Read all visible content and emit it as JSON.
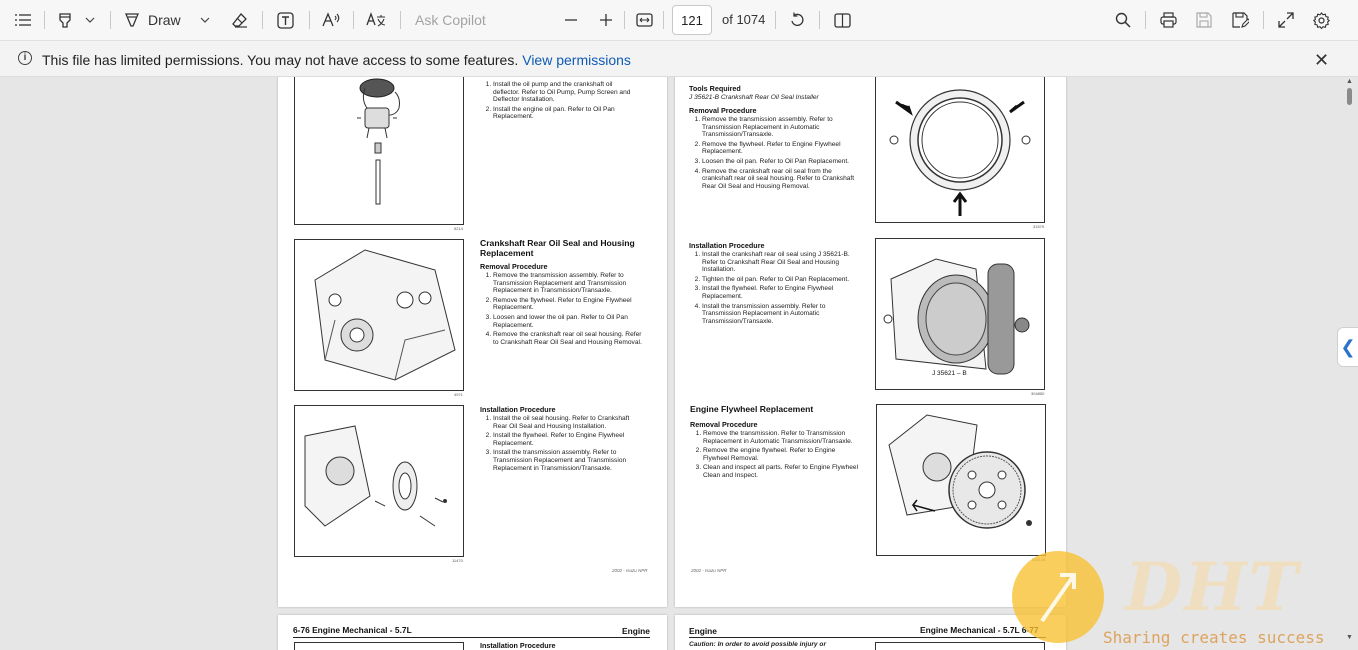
{
  "toolbar": {
    "draw_label": "Draw",
    "ask_copilot_placeholder": "Ask Copilot",
    "current_page": "121",
    "page_total": "of 1074"
  },
  "infobar": {
    "message": "This file has limited permissions. You may not have access to some features.",
    "link": "View permissions"
  },
  "page_left_top": {
    "install_steps": [
      "Install the oil pump and the crankshaft oil deflector. Refer to Oil Pump, Pump Screen and Deflector Installation.",
      "Install the engine oil pan. Refer to Oil Pan Replacement."
    ],
    "fig1_num": "5214",
    "section_title": "Crankshaft Rear Oil Seal and Housing Replacement",
    "removal_heading": "Removal Procedure",
    "removal_steps": [
      "Remove the transmission assembly. Refer to Transmission Replacement and Transmission Replacement in Transmission/Transaxle.",
      "Remove the flywheel. Refer to Engine Flywheel Replacement.",
      "Loosen and lower the oil pan. Refer to Oil Pan Replacement.",
      "Remove the crankshaft rear oil seal housing. Refer to Crankshaft Rear Oil Seal and Housing Removal."
    ],
    "fig2_num": "4971",
    "installation_heading": "Installation Procedure",
    "installation_steps": [
      "Install the oil seal housing. Refer to Crankshaft Rear Oil Seal and Housing Installation.",
      "Install the flywheel. Refer to Engine Flywheel Replacement.",
      "Install the transmission assembly. Refer to Transmission Replacement and Transmission Replacement in Transmission/Transaxle."
    ],
    "fig3_num": "11470",
    "footer": "2002 - Isuzu NPR"
  },
  "page_right_top": {
    "tools_heading": "Tools Required",
    "tools_item": "J 35621-B Crankshaft Rear Oil Seal Installer",
    "removal_heading": "Removal Procedure",
    "removal_steps": [
      "Remove the transmission assembly. Refer to Transmission Replacement in Automatic Transmission/Transaxle.",
      "Remove the flywheel. Refer to Engine Flywheel Replacement.",
      "Loosen the oil pan. Refer to Oil Pan Replacement.",
      "Remove the crankshaft rear oil seal from the crankshaft rear oil seal housing. Refer to Crankshaft Rear Oil Seal and Housing Removal."
    ],
    "fig1_num": "31579",
    "installation_heading": "Installation Procedure",
    "installation_steps": [
      "Install the crankshaft rear oil seal using J 35621-B. Refer to Crankshaft Rear Oil Seal and Housing Installation.",
      "Tighten the oil pan. Refer to Oil Pan Replacement.",
      "Install the flywheel. Refer to Engine Flywheel Replacement.",
      "Install the transmission assembly. Refer to Transmission Replacement in Automatic Transmission/Transaxle."
    ],
    "tool_label": "J 35621 – B",
    "fig2_num": "304850",
    "flywheel_title": "Engine Flywheel Replacement",
    "flywheel_removal_heading": "Removal Procedure",
    "flywheel_removal_steps": [
      "Remove the transmission. Refer to Transmission Replacement in Automatic Transmission/Transaxle.",
      "Remove the engine flywheel. Refer to Engine Flywheel Removal.",
      "Clean and inspect all parts. Refer to Engine Flywheel Clean and Inspect."
    ],
    "fig3_num": "525148",
    "footer": "2002 - Isuzu NPR"
  },
  "page_left_bottom": {
    "header_left": "6-76   Engine Mechanical - 5.7L",
    "header_right": "Engine",
    "installation_heading": "Installation Procedure"
  },
  "page_right_bottom": {
    "header_left": "Engine",
    "header_right": "Engine Mechanical - 5.7L   6-77",
    "caution": "Caution: In order to avoid possible injury or"
  },
  "watermark": {
    "brand": "DHT",
    "tagline": "Sharing creates success"
  },
  "colors": {
    "link": "#0f5ab5",
    "toolbar_bg": "#f7f7f7",
    "viewer_bg": "#e6e6e6",
    "side_tab_chevron": "#2a73c8"
  },
  "icons": [
    "contents-icon",
    "highlight-icon",
    "chevron-down-icon",
    "draw-icon",
    "eraser-icon",
    "text-box-icon",
    "read-aloud-icon",
    "translate-icon",
    "zoom-out-icon",
    "zoom-in-icon",
    "fit-width-icon",
    "rotate-icon",
    "page-view-icon",
    "search-icon",
    "print-icon",
    "save-icon",
    "save-as-icon",
    "fullscreen-icon",
    "settings-icon",
    "info-icon",
    "close-icon",
    "collapse-panel-icon"
  ]
}
